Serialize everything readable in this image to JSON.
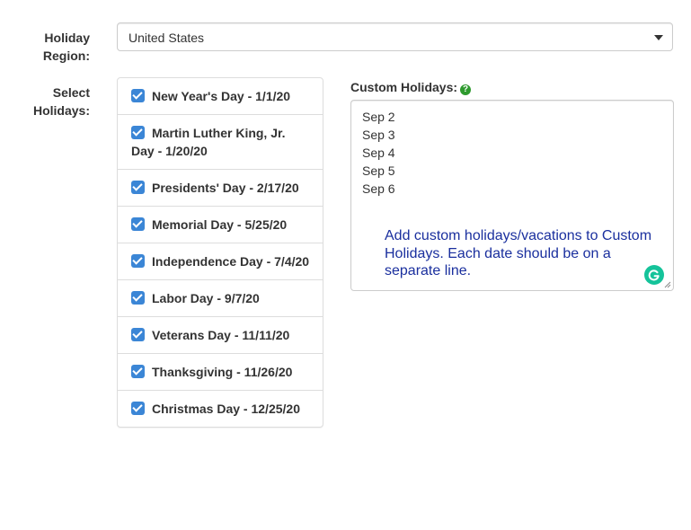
{
  "form": {
    "region_label_line1": "Holiday",
    "region_label_line2": "Region:",
    "region_value": "United States",
    "holidays_label_line1": "Select",
    "holidays_label_line2": "Holidays:"
  },
  "holidays": [
    {
      "label": "New Year's Day - 1/1/20",
      "checked": true
    },
    {
      "label": "Martin Luther King, Jr. Day - 1/20/20",
      "checked": true
    },
    {
      "label": "Presidents' Day - 2/17/20",
      "checked": true
    },
    {
      "label": "Memorial Day - 5/25/20",
      "checked": true
    },
    {
      "label": "Independence Day - 7/4/20",
      "checked": true
    },
    {
      "label": "Labor Day - 9/7/20",
      "checked": true
    },
    {
      "label": "Veterans Day - 11/11/20",
      "checked": true
    },
    {
      "label": "Thanksgiving - 11/26/20",
      "checked": true
    },
    {
      "label": "Christmas Day - 12/25/20",
      "checked": true
    }
  ],
  "custom": {
    "label": "Custom Holidays:",
    "help_icon": "question-circle-icon",
    "lines": [
      "Sep 2",
      "Sep 3",
      "Sep 4",
      "Sep 5",
      "Sep 6"
    ],
    "hint": "Add custom holidays/vacations to Custom Holidays. Each date should be on a separate line."
  },
  "colors": {
    "checkbox": "#3b86d6",
    "help_icon": "#2e9a2e",
    "hint_text": "#1a2f9e",
    "grammarly": "#15c39a"
  }
}
